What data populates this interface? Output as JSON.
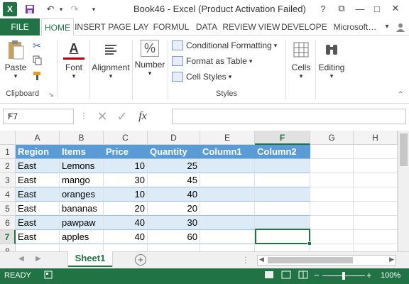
{
  "window": {
    "title": "Book46 - Excel (Product Activation Failed)",
    "buttons": {
      "help": "?",
      "restore": "⧉",
      "minimize": "—",
      "maximize": "□",
      "close": "✕"
    }
  },
  "qat": {
    "app_icon": "X",
    "save": "💾",
    "undo": "↶",
    "redo": "↷",
    "customize": "▾"
  },
  "ribbon_tabs": [
    "FILE",
    "HOME",
    "INSERT",
    "PAGE LAY",
    "FORMUL",
    "DATA",
    "REVIEW",
    "VIEW",
    "DEVELOPE",
    "Microsoft…"
  ],
  "account_dropdown": "▾",
  "ribbon": {
    "clipboard": {
      "paste": "Paste",
      "label": "Clipboard",
      "launcher": "↘"
    },
    "font": {
      "label": "Font",
      "icon_char": "A"
    },
    "alignment": {
      "label": "Alignment"
    },
    "number": {
      "label": "Number",
      "icon_char": "%"
    },
    "styles": {
      "conditional": "Conditional Formatting",
      "format_table": "Format as Table",
      "cell_styles": "Cell Styles",
      "label": "Styles"
    },
    "cells": {
      "label": "Cells"
    },
    "editing": {
      "label": "Editing"
    }
  },
  "formula_bar": {
    "name_box": "F7",
    "fx": "fx",
    "value": ""
  },
  "columns": [
    "A",
    "B",
    "C",
    "D",
    "E",
    "F",
    "G",
    "H"
  ],
  "selected_column": "F",
  "rows": [
    "1",
    "2",
    "3",
    "4",
    "5",
    "6",
    "7",
    "8"
  ],
  "selected_row": "7",
  "table": {
    "headers": [
      "Region",
      "Items",
      "Price",
      "Quantity",
      "Column1",
      "Column2"
    ],
    "rows": [
      [
        "East",
        "Lemons",
        "10",
        "25",
        "",
        ""
      ],
      [
        "East",
        "mango",
        "30",
        "45",
        "",
        ""
      ],
      [
        "East",
        "oranges",
        "10",
        "40",
        "",
        ""
      ],
      [
        "East",
        "bananas",
        "20",
        "20",
        "",
        ""
      ],
      [
        "East",
        "pawpaw",
        "40",
        "30",
        "",
        ""
      ],
      [
        "East",
        "apples",
        "40",
        "60",
        "",
        ""
      ]
    ]
  },
  "sheets": [
    "Sheet1"
  ],
  "status": {
    "ready": "READY",
    "zoom": "100%",
    "zoom_minus": "−",
    "zoom_plus": "+"
  },
  "colors": {
    "excel_green": "#217346",
    "table_header": "#5b9bd5",
    "band": "#ddebf7"
  }
}
